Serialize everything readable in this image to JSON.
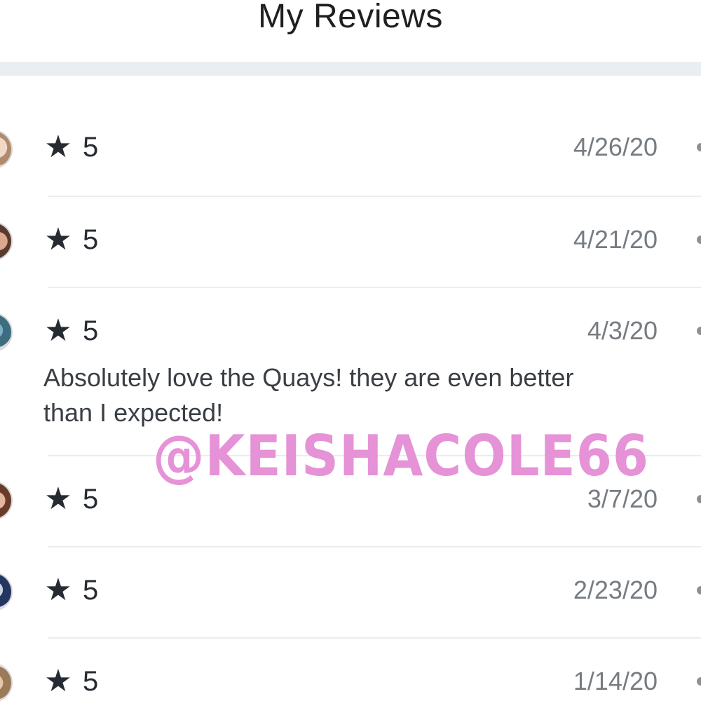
{
  "header": {
    "title": "My Reviews"
  },
  "reviews": [
    {
      "rating": "5",
      "date": "4/26/20",
      "text": ""
    },
    {
      "rating": "5",
      "date": "4/21/20",
      "text": ""
    },
    {
      "rating": "5",
      "date": "4/3/20",
      "text": "Absolutely love the Quays! they are even better than I expected!"
    },
    {
      "rating": "5",
      "date": "3/7/20",
      "text": ""
    },
    {
      "rating": "5",
      "date": "2/23/20",
      "text": ""
    },
    {
      "rating": "5",
      "date": "1/14/20",
      "text": ""
    }
  ],
  "icons": {
    "star": "star-icon",
    "more": "more-icon"
  },
  "watermark": "@KEISHACOLE66",
  "colors": {
    "watermark": "#e592d6",
    "band": "#e8eef1",
    "star": "#262b33",
    "date": "#767c82"
  }
}
